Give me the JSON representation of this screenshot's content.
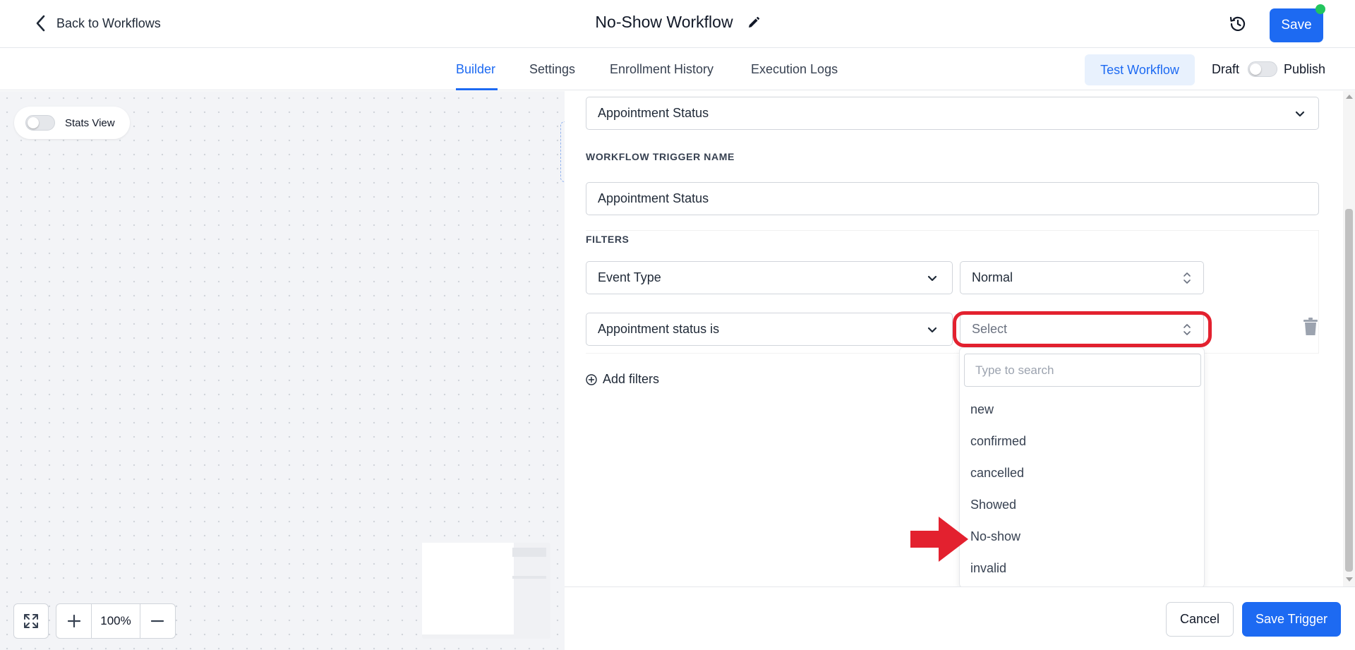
{
  "header": {
    "back_label": "Back to Workflows",
    "workflow_title": "No-Show Workflow",
    "save_label": "Save"
  },
  "tabs": [
    {
      "label": "Builder",
      "active": true
    },
    {
      "label": "Settings",
      "active": false
    },
    {
      "label": "Enrollment History",
      "active": false
    },
    {
      "label": "Execution Logs",
      "active": false
    }
  ],
  "toolbar": {
    "test_label": "Test Workflow",
    "draft_label": "Draft",
    "publish_label": "Publish",
    "publish_on": false
  },
  "canvas": {
    "stats_label": "Stats View",
    "stats_on": false,
    "zoom_level": "100%"
  },
  "trigger_panel": {
    "trigger_type_value": "Appointment Status",
    "trigger_name_label": "WORKFLOW TRIGGER NAME",
    "trigger_name_value": "Appointment Status",
    "filters_label": "FILTERS",
    "filters": [
      {
        "field": "Event Type",
        "value": "Normal"
      },
      {
        "field": "Appointment status is",
        "value": "",
        "placeholder": "Select"
      }
    ],
    "add_filters_label": "Add filters"
  },
  "dropdown": {
    "search_placeholder": "Type to search",
    "options": [
      "new",
      "confirmed",
      "cancelled",
      "Showed",
      "No-show",
      "invalid"
    ]
  },
  "footer": {
    "cancel_label": "Cancel",
    "save_trigger_label": "Save Trigger"
  },
  "colors": {
    "accent": "#1d6af2",
    "highlight": "#e3212f",
    "status_dot": "#22c55e"
  }
}
